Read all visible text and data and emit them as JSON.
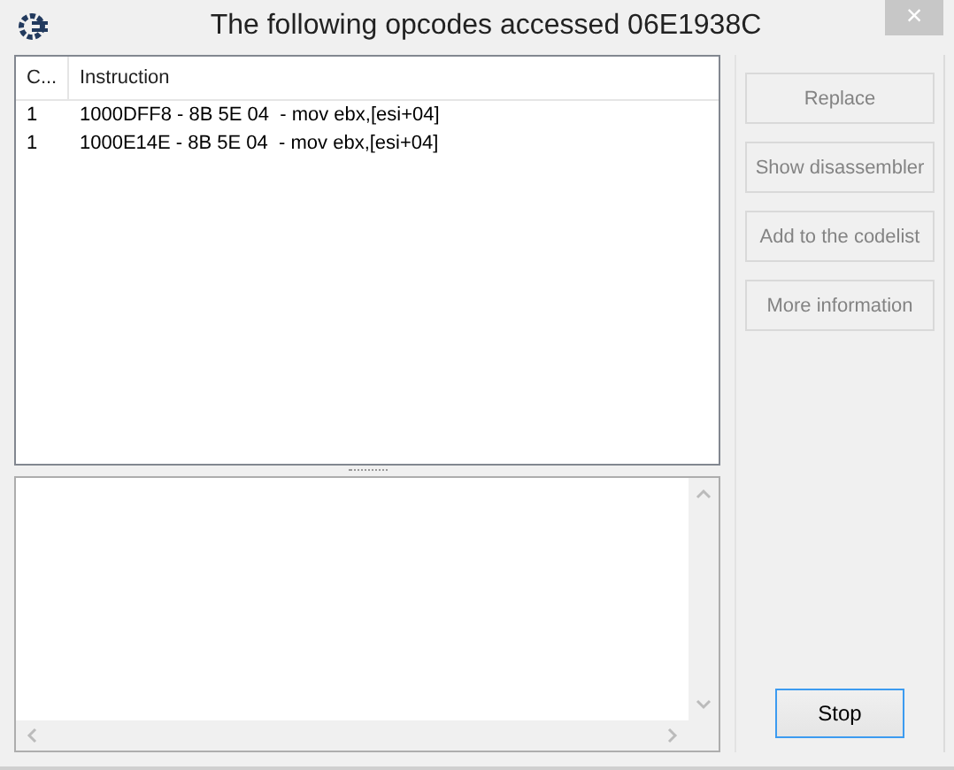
{
  "window": {
    "title": "The following opcodes accessed 06E1938C",
    "close": "×"
  },
  "table": {
    "columns": [
      "C...",
      "Instruction"
    ],
    "rows": [
      {
        "count": "1",
        "instruction": "1000DFF8 - 8B 5E 04  - mov ebx,[esi+04]"
      },
      {
        "count": "1",
        "instruction": "1000E14E - 8B 5E 04  - mov ebx,[esi+04]"
      }
    ]
  },
  "buttons": [
    {
      "label": "Replace",
      "disabled": true
    },
    {
      "label": "Show disassembler",
      "disabled": true
    },
    {
      "label": "Add to the codelist",
      "disabled": true
    },
    {
      "label": "More information",
      "disabled": true
    }
  ],
  "stop_button": {
    "label": "Stop",
    "focused": true
  }
}
